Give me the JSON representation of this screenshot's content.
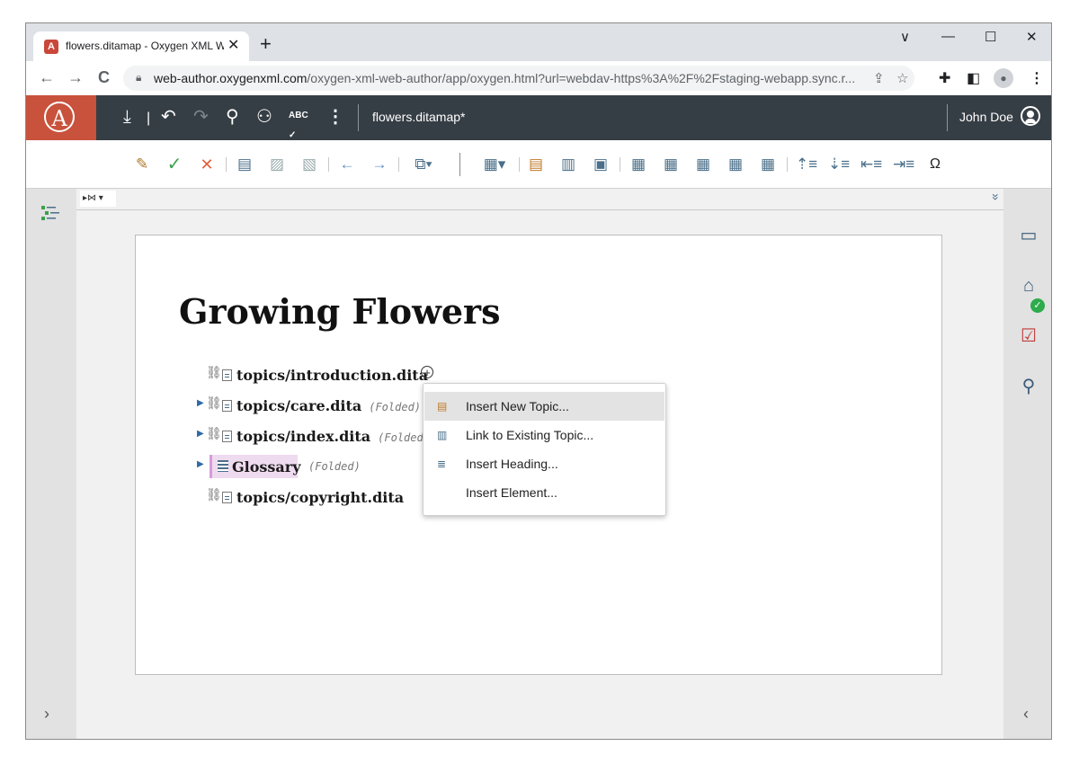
{
  "browser": {
    "tab_title": "flowers.ditamap - Oxygen XML W",
    "tab_close": "✕",
    "new_tab": "+",
    "url_host": "web-author.oxygenxml.com",
    "url_path": "/oxygen-xml-web-author/app/oxygen.html?url=webdav-https%3A%2F%2Fstaging-webapp.sync.r...",
    "nav": {
      "back": "←",
      "forward": "→",
      "reload": "C"
    },
    "window_controls": {
      "chevron": "∨",
      "minimize": "—",
      "maximize": "☐",
      "close": "✕"
    }
  },
  "app": {
    "logo_letter": "A",
    "document_name": "flowers.ditamap*",
    "user_name": "John Doe",
    "header_icons": [
      "download-icon",
      "undo-icon",
      "redo-icon",
      "search-icon",
      "review-icon",
      "spellcheck-icon",
      "more-icon"
    ],
    "spellcheck_label": "ABC"
  },
  "breadcrumb": {
    "item": "▸⋈ ▾",
    "collapse": "»"
  },
  "document": {
    "title": "Growing Flowers",
    "rows": [
      {
        "text": "topics/introduction.dita",
        "folded": ""
      },
      {
        "text": "topics/care.dita",
        "folded": "(Folded)"
      },
      {
        "text": "topics/index.dita",
        "folded": "(Folded)"
      },
      {
        "text": "Glossary",
        "folded": "(Folded)"
      },
      {
        "text": "topics/copyright.dita",
        "folded": ""
      }
    ],
    "plus": "+"
  },
  "context_menu": {
    "items": [
      {
        "label": "Insert New Topic...",
        "icon": "new-topic-icon"
      },
      {
        "label": "Link to Existing Topic...",
        "icon": "link-topic-icon"
      },
      {
        "label": "Insert Heading...",
        "icon": "heading-icon"
      },
      {
        "label": "Insert Element...",
        "icon": ""
      }
    ]
  },
  "toolbar": {
    "symbols_label": "Ω"
  },
  "gutters": {
    "left_expand": "›",
    "right_collapse": "‹"
  },
  "colors": {
    "app_header": "#363e45",
    "logo": "#c8523c",
    "accent": "#4a6f8a",
    "glossary_highlight": "#efdbef",
    "success": "#2eab4c"
  }
}
